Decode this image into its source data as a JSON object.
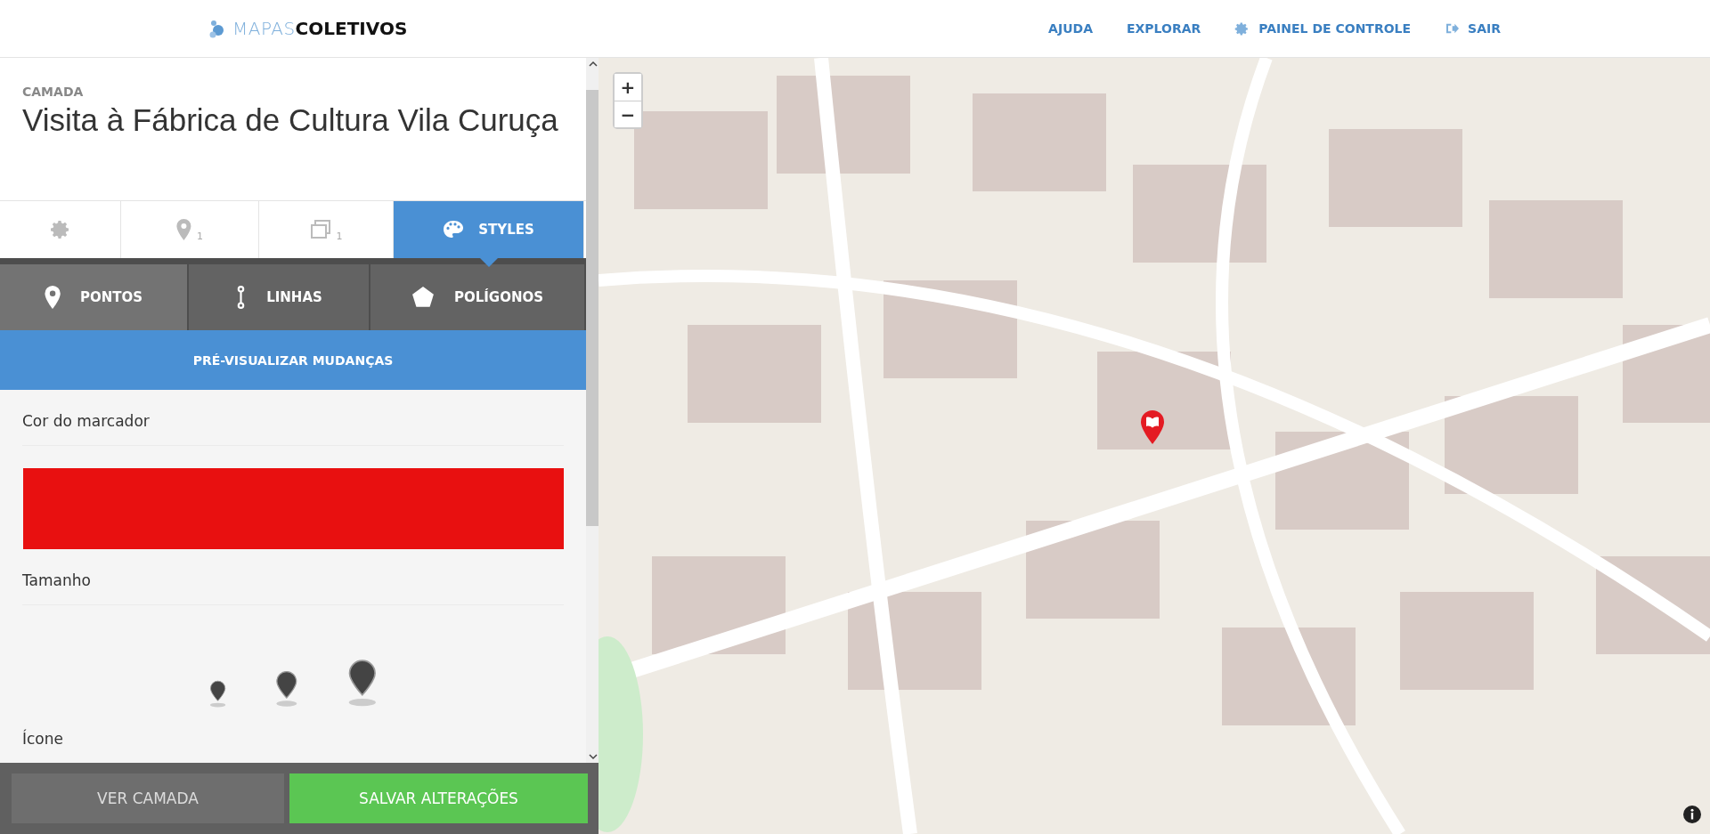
{
  "header": {
    "logo_light": "MAPAS",
    "logo_bold": "COLETIVOS",
    "nav": [
      {
        "label": "AJUDA"
      },
      {
        "label": "EXPLORAR"
      },
      {
        "label": "PAINEL DE CONTROLE"
      },
      {
        "label": "SAIR"
      }
    ]
  },
  "layer": {
    "eyebrow": "CAMADA",
    "title": "Visita à Fábrica de Cultura Vila Curuça"
  },
  "tabs": [
    {
      "selected": false
    },
    {
      "count": "1",
      "selected": false
    },
    {
      "count": "1",
      "selected": false
    },
    {
      "label": "STYLES",
      "selected": true
    }
  ],
  "subtabs": [
    {
      "label": "PONTOS",
      "selected": true
    },
    {
      "label": "LINHAS",
      "selected": false
    },
    {
      "label": "POLÍGONOS",
      "selected": false
    }
  ],
  "preview_button": "PRÉ-VISUALIZAR MUDANÇAS",
  "marker_color": {
    "label": "Cor do marcador",
    "color": "#e81010"
  },
  "size": {
    "label": "Tamanho",
    "options": [
      {
        "kind": "small"
      },
      {
        "kind": "medium"
      },
      {
        "kind": "large"
      }
    ]
  },
  "icon_label": "Ícone",
  "footer": {
    "view_button": "VER CAMADA",
    "save_button": "SALVAR ALTERAÇÕES"
  },
  "map": {
    "zoom_in": "+",
    "zoom_out": "−"
  }
}
